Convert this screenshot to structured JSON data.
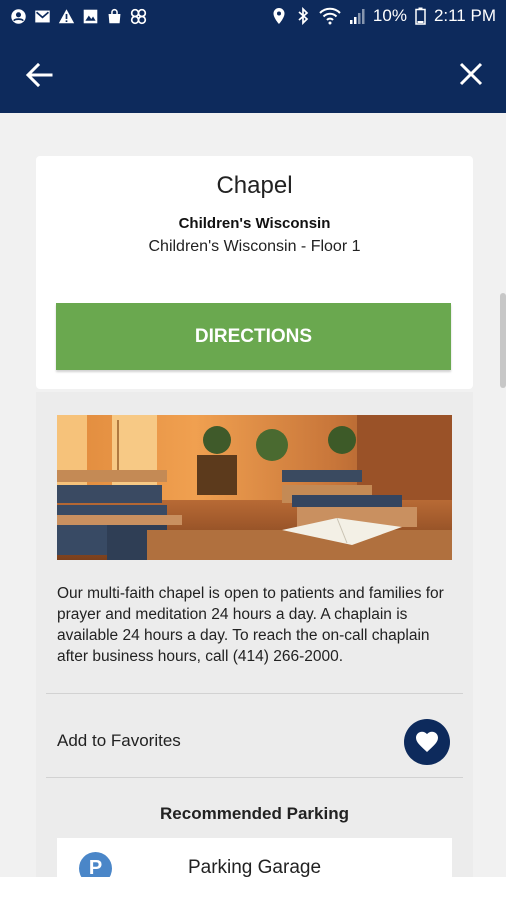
{
  "status_bar": {
    "battery": "10%",
    "time": "2:11 PM",
    "left_icons": [
      "account-circle-icon",
      "gmail-icon",
      "warning-icon",
      "image-icon",
      "shopping-bag-icon",
      "pinwheel-icon"
    ],
    "right_icons": [
      "location-pin-icon",
      "bluetooth-icon",
      "wifi-icon",
      "signal-icon",
      "battery-icon"
    ]
  },
  "app_bar": {
    "back_icon": "arrow-left-icon",
    "close_icon": "close-icon",
    "color": "#0d2a5c"
  },
  "place": {
    "title": "Chapel",
    "organization": "Children's Wisconsin",
    "location": "Children's Wisconsin - Floor 1",
    "directions_label": "DIRECTIONS",
    "directions_color": "#6aa84f"
  },
  "details": {
    "description": "Our multi-faith chapel is open to patients and families for prayer and meditation 24 hours a day. A chaplain is available 24 hours a day. To reach the on-call chaplain after business hours, call (414) 266-2000.",
    "favorites_label": "Add to Favorites",
    "favorite_icon": "heart-icon"
  },
  "parking": {
    "heading": "Recommended Parking",
    "items": [
      {
        "badge": "P",
        "name": "Parking Garage"
      }
    ]
  }
}
